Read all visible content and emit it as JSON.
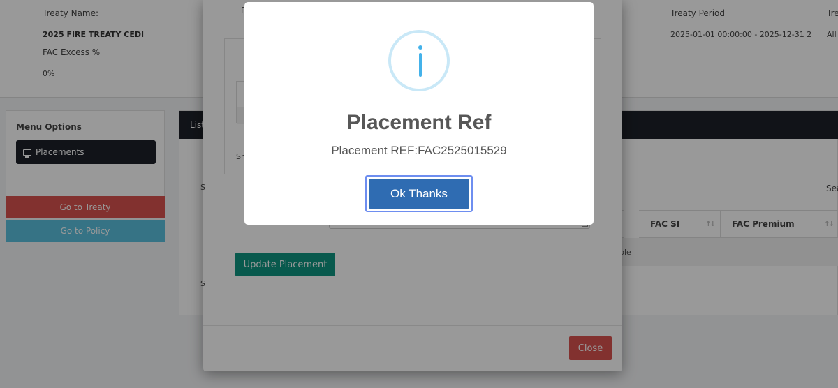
{
  "treaty_info": {
    "treaty_name_label": "Treaty Name:",
    "treaty_name_value": "2025 FIRE TREATY CEDI",
    "fac_excess_label": "FAC Excess %",
    "fac_excess_value": "0%",
    "treaty_period_label": "Treaty Period",
    "treaty_period_value": "2025-01-01 00:00:00 - 2025-12-31 2",
    "right_label_fragment": "Tre",
    "right_value_fragment": "All"
  },
  "menu": {
    "title": "Menu Options",
    "placements_label": "Placements",
    "go_to_treaty": "Go to Treaty",
    "go_to_policy": "Go to Policy"
  },
  "list": {
    "header_fragment": "List",
    "search_fragment": "Sea",
    "columns": [
      "FAC SI",
      "FAC Premium"
    ],
    "empty_text_fragment": "ble"
  },
  "modal": {
    "update_button": "Update Placement",
    "close_button": "Close",
    "fragment_p": "P",
    "fragment_sh": "Sh",
    "fragment_s1": "S",
    "fragment_s2": "S"
  },
  "alert": {
    "title": "Placement Ref",
    "message": "Placement REF:FAC2525015529",
    "ok_button": "Ok Thanks",
    "icon": "info-icon",
    "accent_color": "#44b2ea",
    "button_color": "#2f6cb2"
  }
}
